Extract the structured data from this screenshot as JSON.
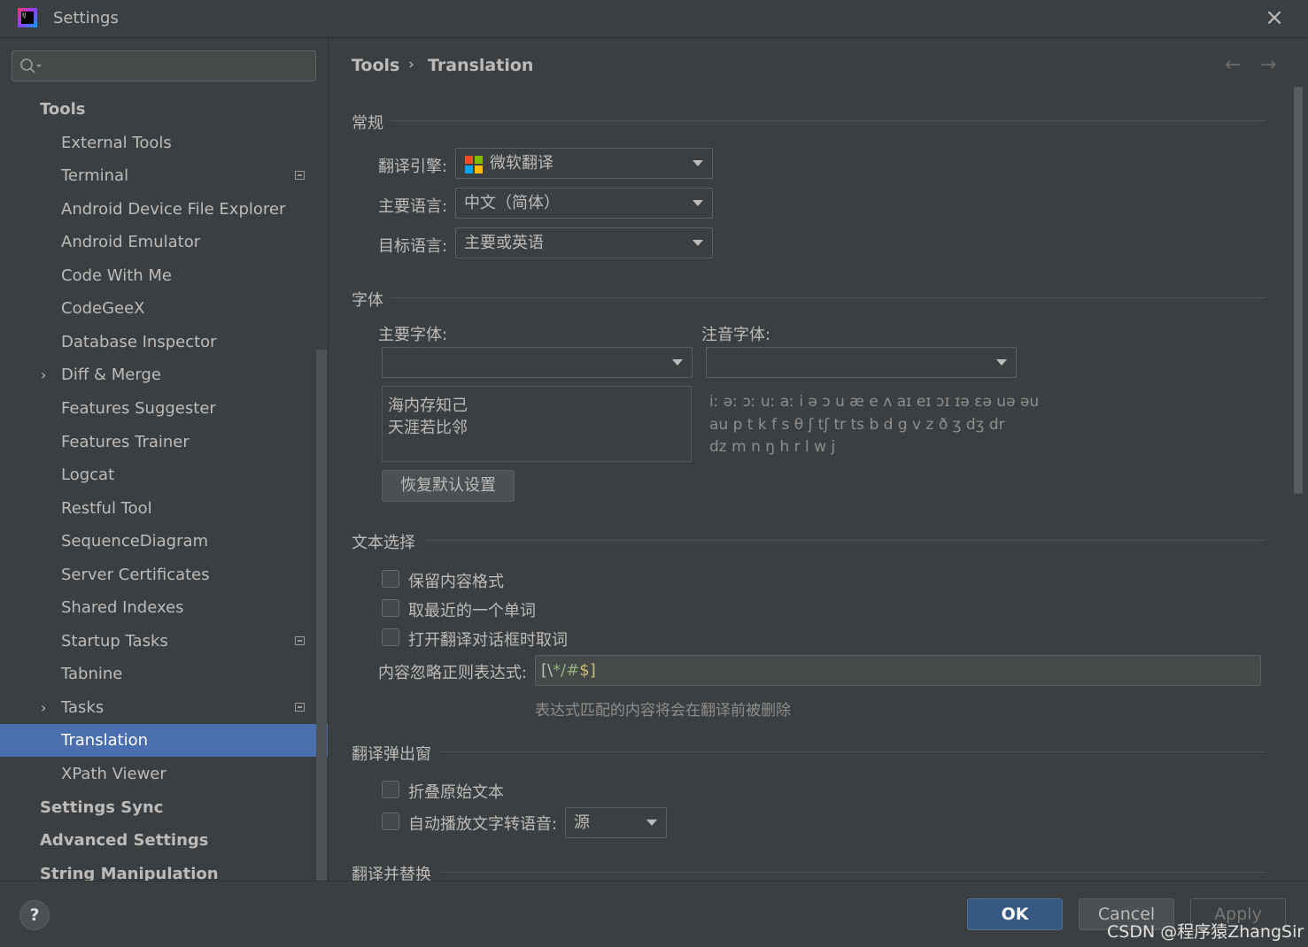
{
  "window": {
    "title": "Settings",
    "app_icon_text": "IJ"
  },
  "search": {
    "placeholder": ""
  },
  "sidebar": {
    "items": [
      {
        "label": "Tools",
        "level": 0
      },
      {
        "label": "External Tools",
        "level": 1
      },
      {
        "label": "Terminal",
        "level": 1,
        "project_icon": true
      },
      {
        "label": "Android Device File Explorer",
        "level": 1
      },
      {
        "label": "Android Emulator",
        "level": 1
      },
      {
        "label": "Code With Me",
        "level": 1
      },
      {
        "label": "CodeGeeX",
        "level": 1
      },
      {
        "label": "Database Inspector",
        "level": 1
      },
      {
        "label": "Diff & Merge",
        "level": 1,
        "expandable": true
      },
      {
        "label": "Features Suggester",
        "level": 1
      },
      {
        "label": "Features Trainer",
        "level": 1
      },
      {
        "label": "Logcat",
        "level": 1
      },
      {
        "label": "Restful Tool",
        "level": 1
      },
      {
        "label": "SequenceDiagram",
        "level": 1
      },
      {
        "label": "Server Certificates",
        "level": 1
      },
      {
        "label": "Shared Indexes",
        "level": 1
      },
      {
        "label": "Startup Tasks",
        "level": 1,
        "project_icon": true
      },
      {
        "label": "Tabnine",
        "level": 1
      },
      {
        "label": "Tasks",
        "level": 1,
        "expandable": true,
        "project_icon": true
      },
      {
        "label": "Translation",
        "level": 1,
        "selected": true
      },
      {
        "label": "XPath Viewer",
        "level": 1
      },
      {
        "label": "Settings Sync",
        "level": 0
      },
      {
        "label": "Advanced Settings",
        "level": 0
      },
      {
        "label": "String Manipulation",
        "level": 0
      }
    ]
  },
  "breadcrumb": {
    "parent": "Tools",
    "separator": "›",
    "current": "Translation"
  },
  "sections": {
    "general": "常规",
    "font": "字体",
    "text_selection": "文本选择",
    "popup": "翻译弹出窗",
    "replace": "翻译并替换"
  },
  "general": {
    "engine_label": "翻译引擎:",
    "engine_value": "微软翻译",
    "primary_lang_label": "主要语言:",
    "primary_lang_value": "中文（简体）",
    "target_lang_label": "目标语言:",
    "target_lang_value": "主要或英语"
  },
  "font": {
    "primary_font_label": "主要字体:",
    "phonetic_font_label": "注音字体:",
    "primary_font_value": "",
    "phonetic_font_value": "",
    "preview_line1": "海内存知己",
    "preview_line2": "天涯若比邻",
    "phonetic_line1": "iː əː ɔː uː aː i ə ɔ u æ e ʌ aɪ eɪ ɔɪ ɪə εə uə əu",
    "phonetic_line2": "au p t k f s θ ʃ tʃ tr ts b d g v z ð ʒ dʒ dr",
    "phonetic_line3": "dz m n ŋ h r l w j",
    "reset_button": "恢复默认设置"
  },
  "text_selection": {
    "keep_format": "保留内容格式",
    "take_nearest_word": "取最近的一个单词",
    "take_word_on_open": "打开翻译对话框时取词",
    "regex_label": "内容忽略正则表达式:",
    "regex_part1": "[\\",
    "regex_part2": "*/#",
    "regex_part3": "$]",
    "regex_hint": "表达式匹配的内容将会在翻译前被删除"
  },
  "popup": {
    "fold_original": "折叠原始文本",
    "auto_tts": "自动播放文字转语音:",
    "tts_source_value": "源"
  },
  "footer": {
    "help": "?",
    "ok": "OK",
    "cancel": "Cancel",
    "apply": "Apply",
    "watermark": "CSDN @程序猿ZhangSir"
  },
  "colors": {
    "selection": "#4b6eaf",
    "ok_button": "#365880",
    "background": "#3c3f41"
  }
}
